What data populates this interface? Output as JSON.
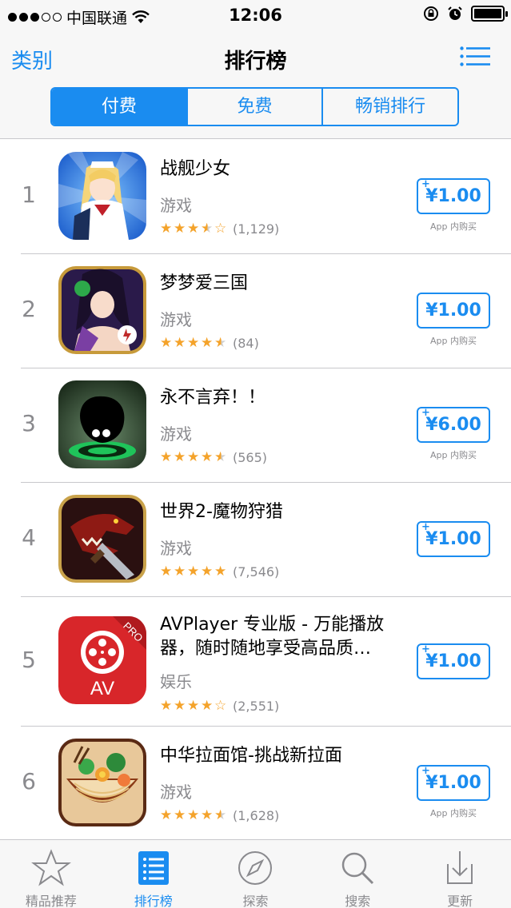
{
  "status": {
    "carrier": "中国联通",
    "time": "12:06"
  },
  "nav": {
    "back_label": "类别",
    "title": "排行榜",
    "segments": [
      "付费",
      "免费",
      "畅销排行"
    ]
  },
  "apps": [
    {
      "rank": "1",
      "name": "战舰少女",
      "category": "游戏",
      "rating": 3.5,
      "count": "(1,129)",
      "price": "¥1.00",
      "iap": "App 内购买",
      "has_plus": true
    },
    {
      "rank": "2",
      "name": "梦梦爱三国",
      "category": "游戏",
      "rating": 4.5,
      "count": "(84)",
      "price": "¥1.00",
      "iap": "App 内购买",
      "has_plus": false
    },
    {
      "rank": "3",
      "name": "永不言弃！！",
      "category": "游戏",
      "rating": 4.5,
      "count": "(565)",
      "price": "¥6.00",
      "iap": "App 内购买",
      "has_plus": true
    },
    {
      "rank": "4",
      "name": "世界2-魔物狩猎",
      "category": "游戏",
      "rating": 5,
      "count": "(7,546)",
      "price": "¥1.00",
      "iap": "",
      "has_plus": true
    },
    {
      "rank": "5",
      "name": "AVPlayer 专业版 - 万能播放器，随时随地享受高品质…",
      "category": "娱乐",
      "rating": 4,
      "count": "(2,551)",
      "price": "¥1.00",
      "iap": "",
      "has_plus": true,
      "icon_text": "AV",
      "icon_badge": "PRO"
    },
    {
      "rank": "6",
      "name": "中华拉面馆-挑战新拉面",
      "category": "游戏",
      "rating": 4.5,
      "count": "(1,628)",
      "price": "¥1.00",
      "iap": "App 内购买",
      "has_plus": true
    }
  ],
  "tabbar": [
    {
      "label": "精品推荐",
      "icon": "star-icon",
      "active": false
    },
    {
      "label": "排行榜",
      "icon": "list-icon",
      "active": true
    },
    {
      "label": "探索",
      "icon": "compass-icon",
      "active": false
    },
    {
      "label": "搜索",
      "icon": "search-icon",
      "active": false
    },
    {
      "label": "更新",
      "icon": "download-icon",
      "active": false
    }
  ],
  "colors": {
    "accent": "#1a8cf0",
    "star": "#f4a32b",
    "gray": "#8a8a8e"
  }
}
